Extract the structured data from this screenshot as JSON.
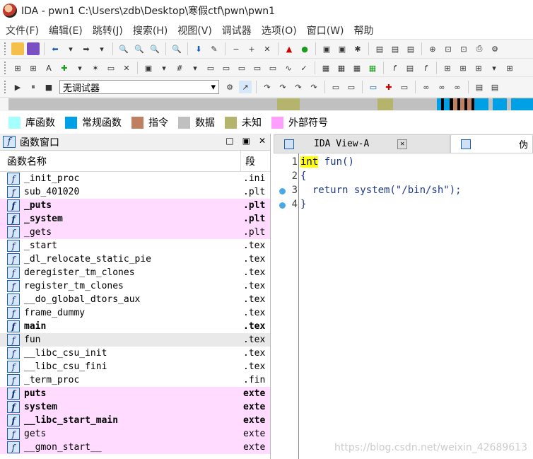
{
  "window": {
    "title": "IDA - pwn1 C:\\Users\\zdb\\Desktop\\寒假ctf\\pwn\\pwn1"
  },
  "menu": [
    "文件(F)",
    "编辑(E)",
    "跳转(J)",
    "搜索(H)",
    "视图(V)",
    "调试器",
    "选项(O)",
    "窗口(W)",
    "帮助"
  ],
  "debugger": {
    "selected": "无调试器"
  },
  "legend": [
    {
      "label": "库函数",
      "color": "#a6ffff"
    },
    {
      "label": "常规函数",
      "color": "#00a0e6"
    },
    {
      "label": "指令",
      "color": "#c08060"
    },
    {
      "label": "数据",
      "color": "#c0c0c0"
    },
    {
      "label": "未知",
      "color": "#b4b46c"
    },
    {
      "label": "外部符号",
      "color": "#ffa0ff"
    }
  ],
  "functions_panel": {
    "title": "函数窗口",
    "col_name": "函数名称",
    "col_segment": "段",
    "rows": [
      {
        "name": "_init_proc",
        "segment": ".init",
        "style": "normal"
      },
      {
        "name": "sub_401020",
        "segment": ".plt",
        "style": "normal"
      },
      {
        "name": "_puts",
        "segment": ".plt",
        "style": "import-bold"
      },
      {
        "name": "_system",
        "segment": ".plt",
        "style": "import-bold"
      },
      {
        "name": "_gets",
        "segment": ".plt",
        "style": "import"
      },
      {
        "name": "_start",
        "segment": ".text",
        "style": "normal"
      },
      {
        "name": "_dl_relocate_static_pie",
        "segment": ".text",
        "style": "normal"
      },
      {
        "name": "deregister_tm_clones",
        "segment": ".text",
        "style": "normal"
      },
      {
        "name": "register_tm_clones",
        "segment": ".text",
        "style": "normal"
      },
      {
        "name": "__do_global_dtors_aux",
        "segment": ".text",
        "style": "normal"
      },
      {
        "name": "frame_dummy",
        "segment": ".text",
        "style": "normal"
      },
      {
        "name": "main",
        "segment": ".text",
        "style": "bold"
      },
      {
        "name": "fun",
        "segment": ".text",
        "style": "selected"
      },
      {
        "name": "__libc_csu_init",
        "segment": ".text",
        "style": "normal"
      },
      {
        "name": "__libc_csu_fini",
        "segment": ".text",
        "style": "normal"
      },
      {
        "name": "_term_proc",
        "segment": ".fini",
        "style": "normal"
      },
      {
        "name": "puts",
        "segment": "exter",
        "style": "import-bold"
      },
      {
        "name": "system",
        "segment": "exter",
        "style": "import-bold"
      },
      {
        "name": "__libc_start_main",
        "segment": "exter",
        "style": "import-bold"
      },
      {
        "name": "gets",
        "segment": "exter",
        "style": "import"
      },
      {
        "name": "__gmon_start__",
        "segment": "exter",
        "style": "import"
      }
    ]
  },
  "tabs": [
    {
      "label": "IDA View-A",
      "active": false
    },
    {
      "label": "伪",
      "active": true
    }
  ],
  "code": {
    "lines": [
      {
        "num": "1",
        "kw": "int",
        "rest": " fun()",
        "dot": false
      },
      {
        "num": "2",
        "kw": "",
        "rest": "{",
        "dot": false
      },
      {
        "num": "3",
        "kw": "",
        "rest": "  return system(\"/bin/sh\");",
        "dot": true
      },
      {
        "num": "4",
        "kw": "",
        "rest": "}",
        "dot": true
      }
    ]
  },
  "watermark": "https://blog.csdn.net/weixin_42689613"
}
